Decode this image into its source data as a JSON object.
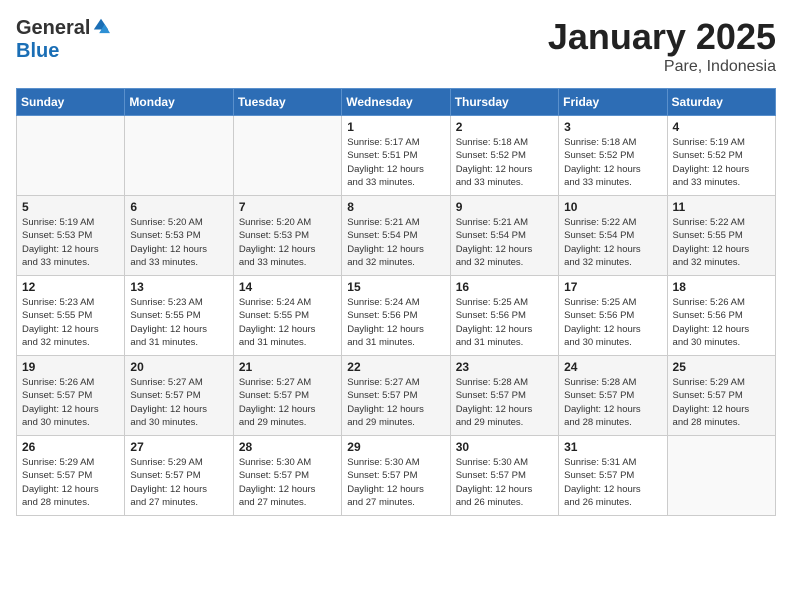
{
  "header": {
    "logo_general": "General",
    "logo_blue": "Blue",
    "month_title": "January 2025",
    "location": "Pare, Indonesia"
  },
  "weekdays": [
    "Sunday",
    "Monday",
    "Tuesday",
    "Wednesday",
    "Thursday",
    "Friday",
    "Saturday"
  ],
  "weeks": [
    [
      {
        "day": "",
        "info": ""
      },
      {
        "day": "",
        "info": ""
      },
      {
        "day": "",
        "info": ""
      },
      {
        "day": "1",
        "info": "Sunrise: 5:17 AM\nSunset: 5:51 PM\nDaylight: 12 hours\nand 33 minutes."
      },
      {
        "day": "2",
        "info": "Sunrise: 5:18 AM\nSunset: 5:52 PM\nDaylight: 12 hours\nand 33 minutes."
      },
      {
        "day": "3",
        "info": "Sunrise: 5:18 AM\nSunset: 5:52 PM\nDaylight: 12 hours\nand 33 minutes."
      },
      {
        "day": "4",
        "info": "Sunrise: 5:19 AM\nSunset: 5:52 PM\nDaylight: 12 hours\nand 33 minutes."
      }
    ],
    [
      {
        "day": "5",
        "info": "Sunrise: 5:19 AM\nSunset: 5:53 PM\nDaylight: 12 hours\nand 33 minutes."
      },
      {
        "day": "6",
        "info": "Sunrise: 5:20 AM\nSunset: 5:53 PM\nDaylight: 12 hours\nand 33 minutes."
      },
      {
        "day": "7",
        "info": "Sunrise: 5:20 AM\nSunset: 5:53 PM\nDaylight: 12 hours\nand 33 minutes."
      },
      {
        "day": "8",
        "info": "Sunrise: 5:21 AM\nSunset: 5:54 PM\nDaylight: 12 hours\nand 32 minutes."
      },
      {
        "day": "9",
        "info": "Sunrise: 5:21 AM\nSunset: 5:54 PM\nDaylight: 12 hours\nand 32 minutes."
      },
      {
        "day": "10",
        "info": "Sunrise: 5:22 AM\nSunset: 5:54 PM\nDaylight: 12 hours\nand 32 minutes."
      },
      {
        "day": "11",
        "info": "Sunrise: 5:22 AM\nSunset: 5:55 PM\nDaylight: 12 hours\nand 32 minutes."
      }
    ],
    [
      {
        "day": "12",
        "info": "Sunrise: 5:23 AM\nSunset: 5:55 PM\nDaylight: 12 hours\nand 32 minutes."
      },
      {
        "day": "13",
        "info": "Sunrise: 5:23 AM\nSunset: 5:55 PM\nDaylight: 12 hours\nand 31 minutes."
      },
      {
        "day": "14",
        "info": "Sunrise: 5:24 AM\nSunset: 5:55 PM\nDaylight: 12 hours\nand 31 minutes."
      },
      {
        "day": "15",
        "info": "Sunrise: 5:24 AM\nSunset: 5:56 PM\nDaylight: 12 hours\nand 31 minutes."
      },
      {
        "day": "16",
        "info": "Sunrise: 5:25 AM\nSunset: 5:56 PM\nDaylight: 12 hours\nand 31 minutes."
      },
      {
        "day": "17",
        "info": "Sunrise: 5:25 AM\nSunset: 5:56 PM\nDaylight: 12 hours\nand 30 minutes."
      },
      {
        "day": "18",
        "info": "Sunrise: 5:26 AM\nSunset: 5:56 PM\nDaylight: 12 hours\nand 30 minutes."
      }
    ],
    [
      {
        "day": "19",
        "info": "Sunrise: 5:26 AM\nSunset: 5:57 PM\nDaylight: 12 hours\nand 30 minutes."
      },
      {
        "day": "20",
        "info": "Sunrise: 5:27 AM\nSunset: 5:57 PM\nDaylight: 12 hours\nand 30 minutes."
      },
      {
        "day": "21",
        "info": "Sunrise: 5:27 AM\nSunset: 5:57 PM\nDaylight: 12 hours\nand 29 minutes."
      },
      {
        "day": "22",
        "info": "Sunrise: 5:27 AM\nSunset: 5:57 PM\nDaylight: 12 hours\nand 29 minutes."
      },
      {
        "day": "23",
        "info": "Sunrise: 5:28 AM\nSunset: 5:57 PM\nDaylight: 12 hours\nand 29 minutes."
      },
      {
        "day": "24",
        "info": "Sunrise: 5:28 AM\nSunset: 5:57 PM\nDaylight: 12 hours\nand 28 minutes."
      },
      {
        "day": "25",
        "info": "Sunrise: 5:29 AM\nSunset: 5:57 PM\nDaylight: 12 hours\nand 28 minutes."
      }
    ],
    [
      {
        "day": "26",
        "info": "Sunrise: 5:29 AM\nSunset: 5:57 PM\nDaylight: 12 hours\nand 28 minutes."
      },
      {
        "day": "27",
        "info": "Sunrise: 5:29 AM\nSunset: 5:57 PM\nDaylight: 12 hours\nand 27 minutes."
      },
      {
        "day": "28",
        "info": "Sunrise: 5:30 AM\nSunset: 5:57 PM\nDaylight: 12 hours\nand 27 minutes."
      },
      {
        "day": "29",
        "info": "Sunrise: 5:30 AM\nSunset: 5:57 PM\nDaylight: 12 hours\nand 27 minutes."
      },
      {
        "day": "30",
        "info": "Sunrise: 5:30 AM\nSunset: 5:57 PM\nDaylight: 12 hours\nand 26 minutes."
      },
      {
        "day": "31",
        "info": "Sunrise: 5:31 AM\nSunset: 5:57 PM\nDaylight: 12 hours\nand 26 minutes."
      },
      {
        "day": "",
        "info": ""
      }
    ]
  ]
}
